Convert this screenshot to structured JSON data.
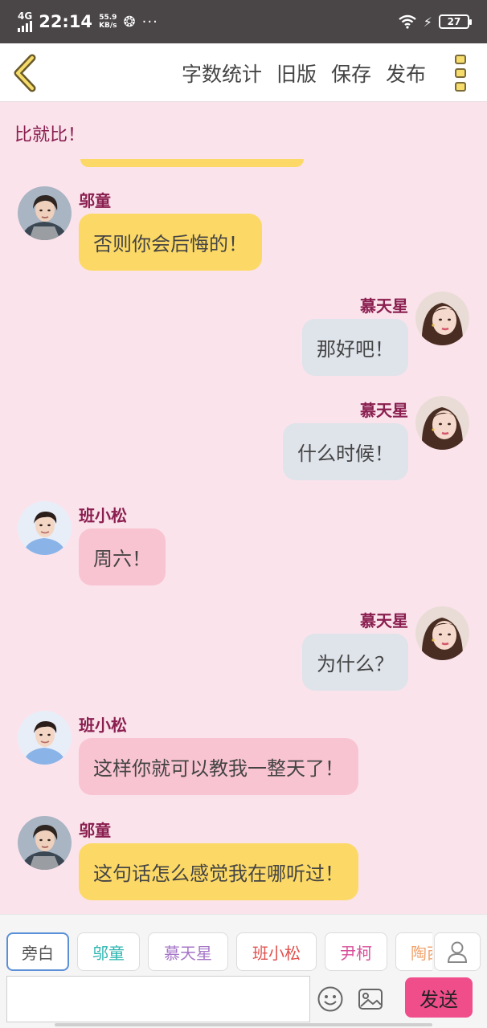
{
  "status_bar": {
    "network": "4G",
    "time": "22:14",
    "speed_value": "55.9",
    "speed_unit": "KB/s",
    "battery": "27"
  },
  "toolbar": {
    "actions": [
      "字数统计",
      "旧版",
      "保存",
      "发布"
    ]
  },
  "chat": {
    "narration": "比就比！",
    "messages": [
      {
        "side": "left",
        "name": "邬童",
        "text": "否则你会后悔的！",
        "color": "yellow"
      },
      {
        "side": "right",
        "name": "慕天星",
        "text": "那好吧！",
        "color": "gray"
      },
      {
        "side": "right",
        "name": "慕天星",
        "text": "什么时候！",
        "color": "gray"
      },
      {
        "side": "left",
        "name": "班小松",
        "text": "周六！",
        "color": "pink"
      },
      {
        "side": "right",
        "name": "慕天星",
        "text": "为什么？",
        "color": "gray"
      },
      {
        "side": "left",
        "name": "班小松",
        "text": "这样你就可以教我一整天了！",
        "color": "pink"
      },
      {
        "side": "left",
        "name": "邬童",
        "text": "这句话怎么感觉我在哪听过！",
        "color": "yellow"
      }
    ]
  },
  "roles": [
    {
      "label": "旁白",
      "color": "#555555",
      "active": true
    },
    {
      "label": "邬童",
      "color": "#2bb5b0",
      "active": false
    },
    {
      "label": "慕天星",
      "color": "#a676c8",
      "active": false
    },
    {
      "label": "班小松",
      "color": "#e0524e",
      "active": false
    },
    {
      "label": "尹柯",
      "color": "#d94f9a",
      "active": false
    },
    {
      "label": "陶西",
      "color": "#f0a36e",
      "active": false
    }
  ],
  "composer": {
    "input_value": "",
    "send_label": "发送"
  },
  "colors": {
    "background": "#fbe3ec",
    "name_color": "#8a1f4f",
    "send_button": "#f04e8b"
  }
}
